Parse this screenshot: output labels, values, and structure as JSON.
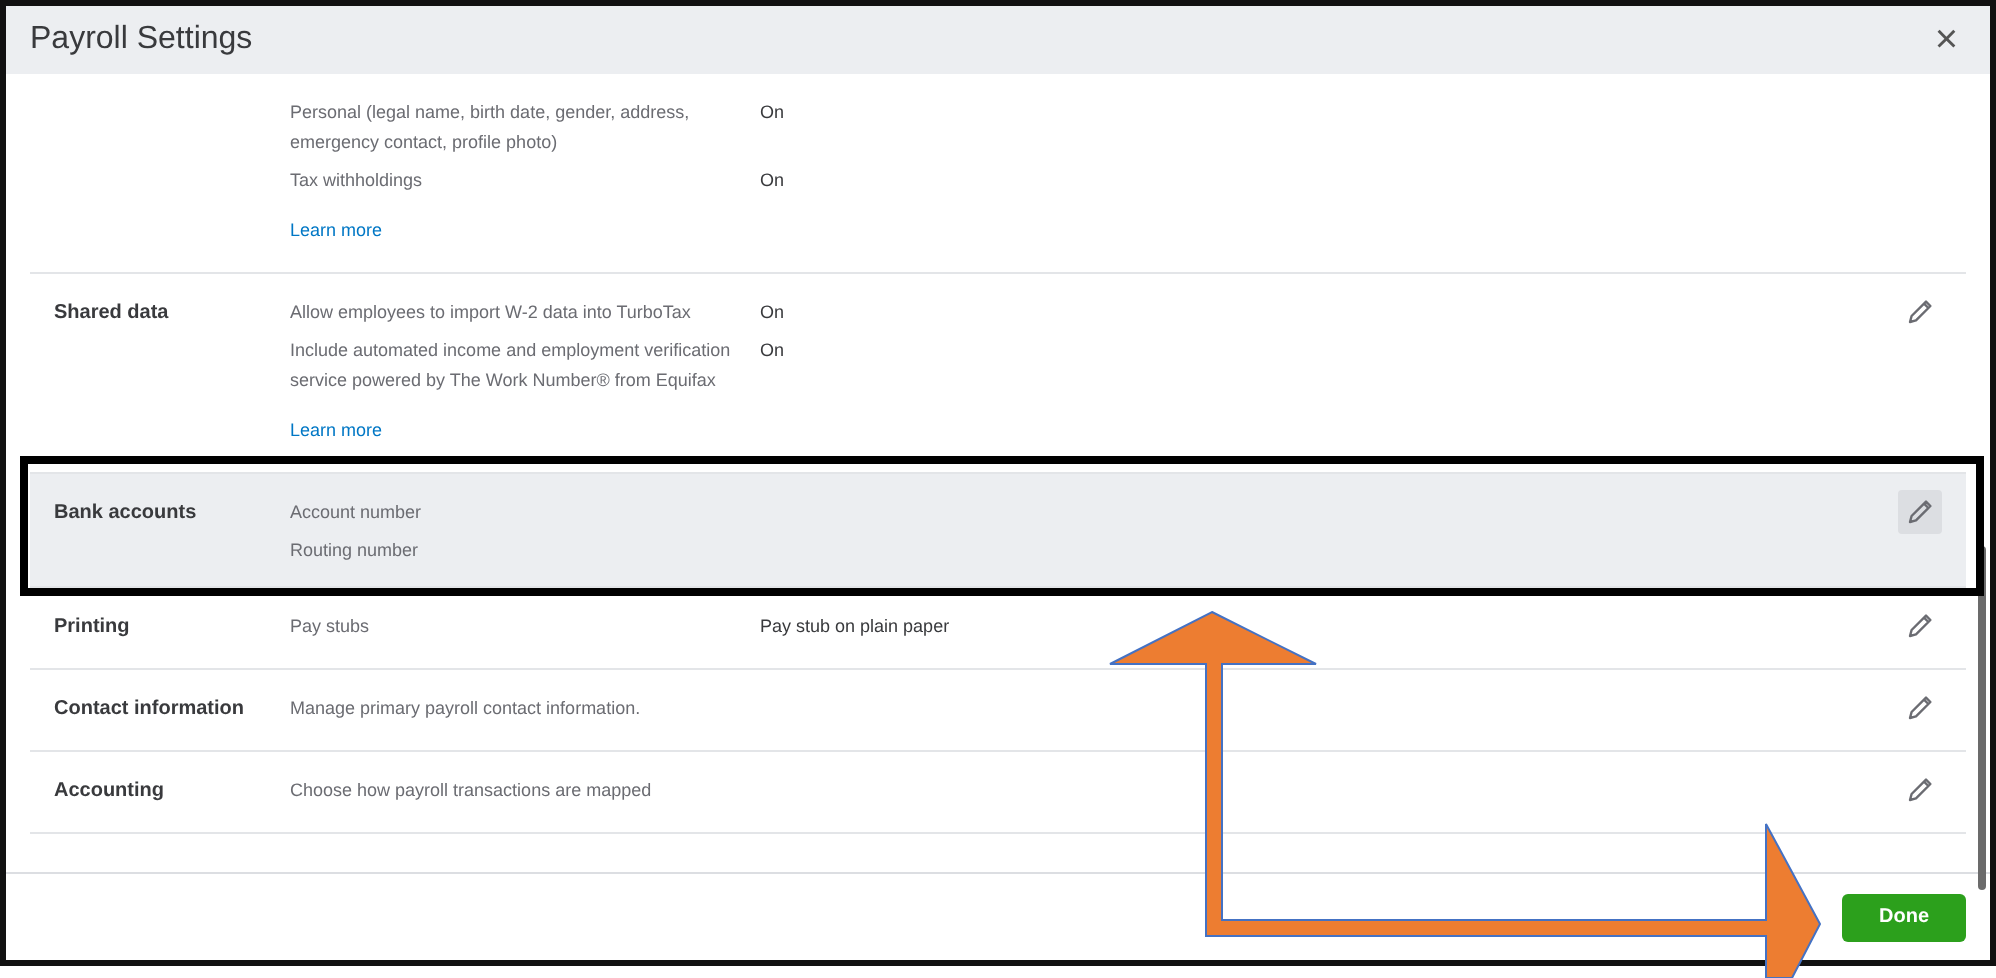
{
  "window": {
    "title": "Payroll Settings",
    "close": "×"
  },
  "sections": [
    {
      "items": [
        {
          "text": "Personal (legal name, birth date, gender, address, emergency contact, profile photo)",
          "value": "On"
        },
        {
          "text": "Tax withholdings",
          "value": "On"
        }
      ],
      "link": "Learn more",
      "editable": false,
      "highlighted": false
    },
    {
      "label": "Shared data",
      "items": [
        {
          "text": "Allow employees to import W-2 data into TurboTax",
          "value": "On"
        },
        {
          "text": "Include automated income and employment verification service powered by The Work Number® from Equifax",
          "value": "On"
        }
      ],
      "link": "Learn more",
      "editable": true,
      "highlighted": false
    },
    {
      "label": "Bank accounts",
      "items": [
        {
          "text": "Account number"
        },
        {
          "text": "Routing number"
        }
      ],
      "editable": true,
      "highlighted": true
    },
    {
      "label": "Printing",
      "items": [
        {
          "text": "Pay stubs",
          "value": "Pay stub on plain paper"
        }
      ],
      "editable": true,
      "highlighted": false
    },
    {
      "label": "Contact information",
      "items": [
        {
          "text": "Manage primary payroll contact information."
        }
      ],
      "editable": true,
      "highlighted": false
    },
    {
      "label": "Accounting",
      "items": [
        {
          "text": "Choose how payroll transactions are mapped"
        }
      ],
      "editable": true,
      "highlighted": false
    }
  ],
  "footer": {
    "done": "Done"
  }
}
